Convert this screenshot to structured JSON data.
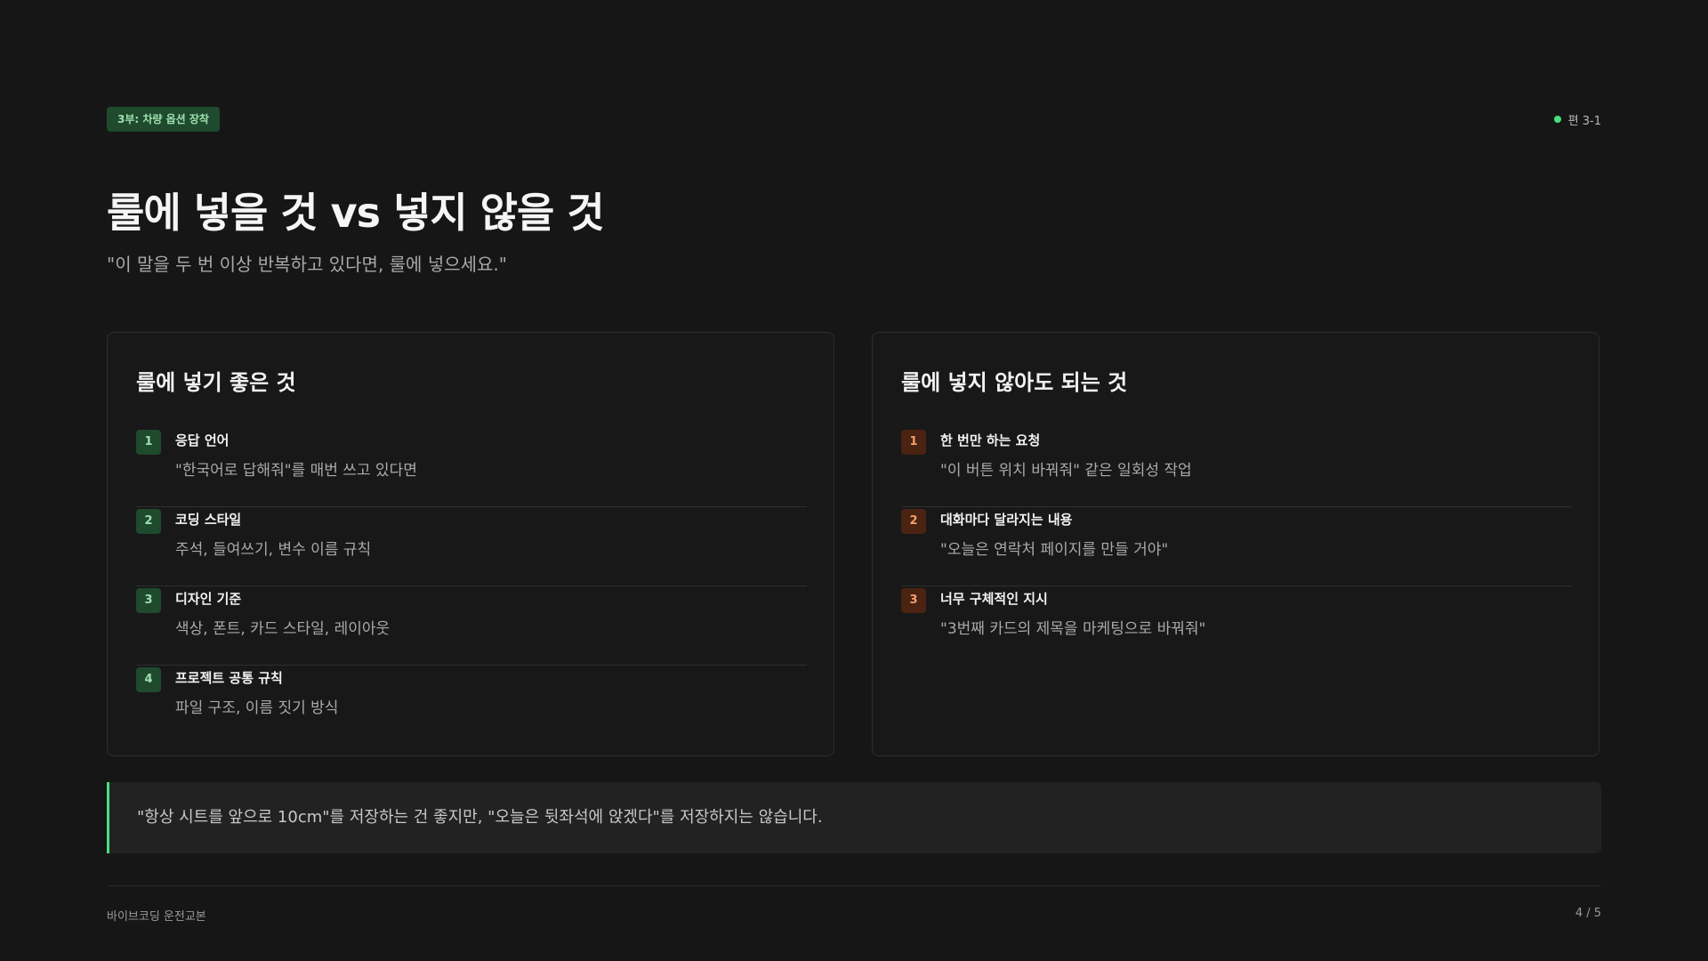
{
  "header": {
    "part_badge": "3부: 차량 옵션 장착",
    "episode": "편 3-1",
    "episode_dot_color": "#4ade80"
  },
  "title": "룰에 넣을 것 vs 넣지 않을 것",
  "subtitle": "\"이 말을 두 번 이상 반복하고 있다면, 룰에 넣으세요.\"",
  "left_card": {
    "title": "룰에 넣기 좋은 것",
    "accent": "#1f4a2e",
    "items": [
      {
        "num": "1",
        "title": "응답 언어",
        "desc": "\"한국어로 답해줘\"를 매번 쓰고 있다면"
      },
      {
        "num": "2",
        "title": "코딩 스타일",
        "desc": "주석, 들여쓰기, 변수 이름 규칙"
      },
      {
        "num": "3",
        "title": "디자인 기준",
        "desc": "색상, 폰트, 카드 스타일, 레이아웃"
      },
      {
        "num": "4",
        "title": "프로젝트 공통 규칙",
        "desc": "파일 구조, 이름 짓기 방식"
      }
    ]
  },
  "right_card": {
    "title": "룰에 넣지 않아도 되는 것",
    "accent": "#4a2312",
    "items": [
      {
        "num": "1",
        "title": "한 번만 하는 요청",
        "desc": "\"이 버튼 위치 바꿔줘\" 같은 일회성 작업"
      },
      {
        "num": "2",
        "title": "대화마다 달라지는 내용",
        "desc": "\"오늘은 연락처 페이지를 만들 거야\""
      },
      {
        "num": "3",
        "title": "너무 구체적인 지시",
        "desc": "\"3번째 카드의 제목을 마케팅으로 바꿔줘\""
      }
    ]
  },
  "quote": {
    "text": "\"항상 시트를 앞으로 10cm\"를 저장하는 건 좋지만, \"오늘은 뒷좌석에 앉겠다\"를 저장하지는 않습니다.",
    "border_color": "#4ade80"
  },
  "footer": {
    "left": "바이브코딩 운전교본",
    "page": "4 / 5"
  }
}
